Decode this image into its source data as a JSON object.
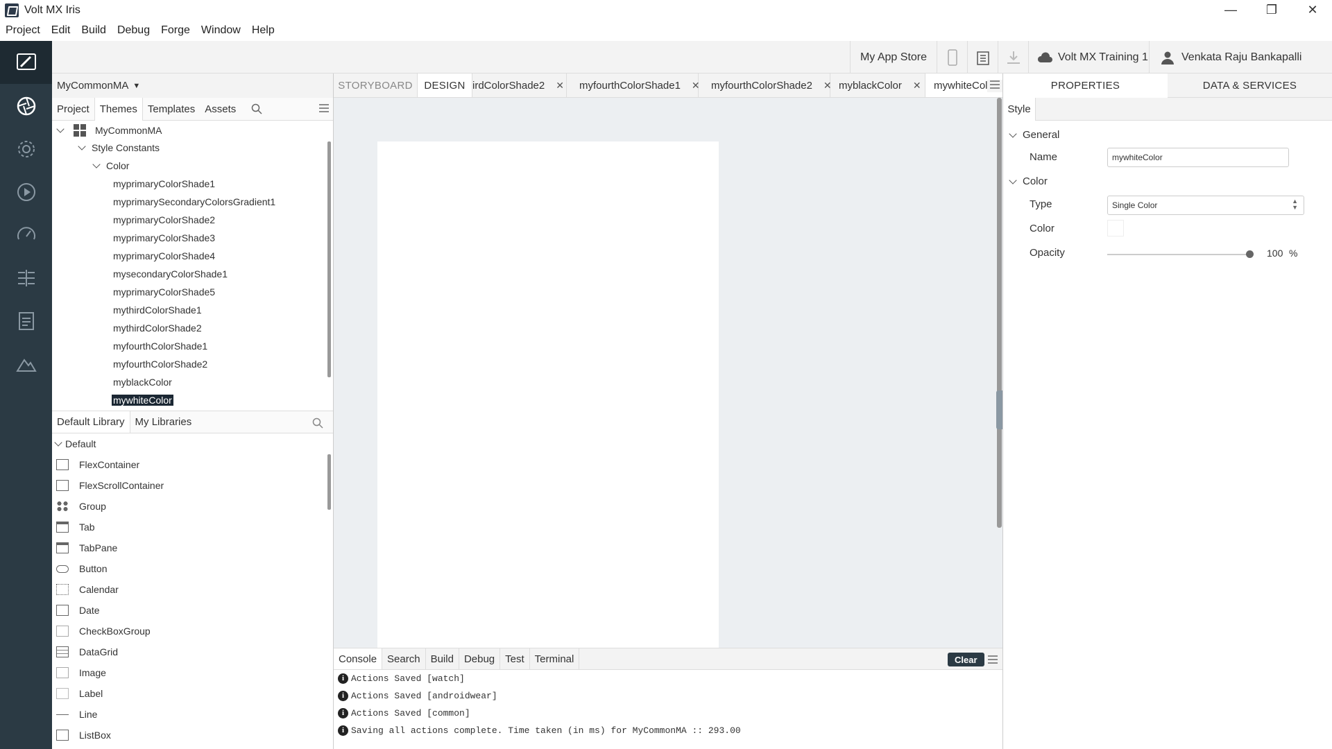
{
  "window": {
    "title": "Volt MX Iris",
    "minimize": "—",
    "maximize": "❐",
    "close": "✕"
  },
  "menu": [
    "Project",
    "Edit",
    "Build",
    "Debug",
    "Forge",
    "Window",
    "Help"
  ],
  "toolbar": {
    "app_store": "My App Store",
    "cloud": "Volt MX Training 1",
    "user": "Venkata Raju Bankapalli"
  },
  "project": {
    "name": "MyCommonMA",
    "tabs": [
      "Project",
      "Themes",
      "Templates",
      "Assets"
    ],
    "active_tab": "Themes"
  },
  "tree": {
    "root": "MyCommonMA",
    "group": "Style Constants",
    "subgroup": "Color",
    "items": [
      "myprimaryColorShade1",
      "myprimarySecondaryColorsGradient1",
      "myprimaryColorShade2",
      "myprimaryColorShade3",
      "myprimaryColorShade4",
      "mysecondaryColorShade1",
      "myprimaryColorShade5",
      "mythirdColorShade1",
      "mythirdColorShade2",
      "myfourthColorShade1",
      "myfourthColorShade2",
      "myblackColor",
      "mywhiteColor"
    ],
    "selected": "mywhiteColor"
  },
  "library": {
    "tabs": [
      "Default Library",
      "My Libraries"
    ],
    "group": "Default",
    "widgets": [
      "FlexContainer",
      "FlexScrollContainer",
      "Group",
      "Tab",
      "TabPane",
      "Button",
      "Calendar",
      "Date",
      "CheckBoxGroup",
      "DataGrid",
      "Image",
      "Label",
      "Line",
      "ListBox"
    ]
  },
  "center": {
    "tabs": [
      {
        "label": "STORYBOARD",
        "closable": false
      },
      {
        "label": "DESIGN",
        "closable": false
      },
      {
        "label": "irdColorShade2",
        "closable": true
      },
      {
        "label": "myfourthColorShade1",
        "closable": true
      },
      {
        "label": "myfourthColorShade2",
        "closable": true
      },
      {
        "label": "myblackColor",
        "closable": true
      },
      {
        "label": "mywhiteColc",
        "closable": false
      }
    ]
  },
  "console": {
    "tabs": [
      "Console",
      "Search",
      "Build",
      "Debug",
      "Test",
      "Terminal"
    ],
    "clear": "Clear",
    "lines": [
      "Actions Saved [watch]",
      "Actions Saved [androidwear]",
      "Actions Saved [common]",
      "Saving all actions complete. Time taken (in ms) for MyCommonMA :: 293.00"
    ]
  },
  "right": {
    "tabs": [
      "PROPERTIES",
      "DATA & SERVICES"
    ],
    "style_tab": "Style",
    "general": "General",
    "name_label": "Name",
    "name_value": "mywhiteColor",
    "color_section": "Color",
    "type_label": "Type",
    "type_value": "Single Color",
    "color_label": "Color",
    "color_value": "#ffffff",
    "opacity_label": "Opacity",
    "opacity_value": "100",
    "opacity_unit": "%",
    "opacity_fraction": 1.0
  },
  "colors": {
    "rail": "#2b3a44",
    "selected": "#1b2733",
    "panel": "#f3f3f3"
  }
}
